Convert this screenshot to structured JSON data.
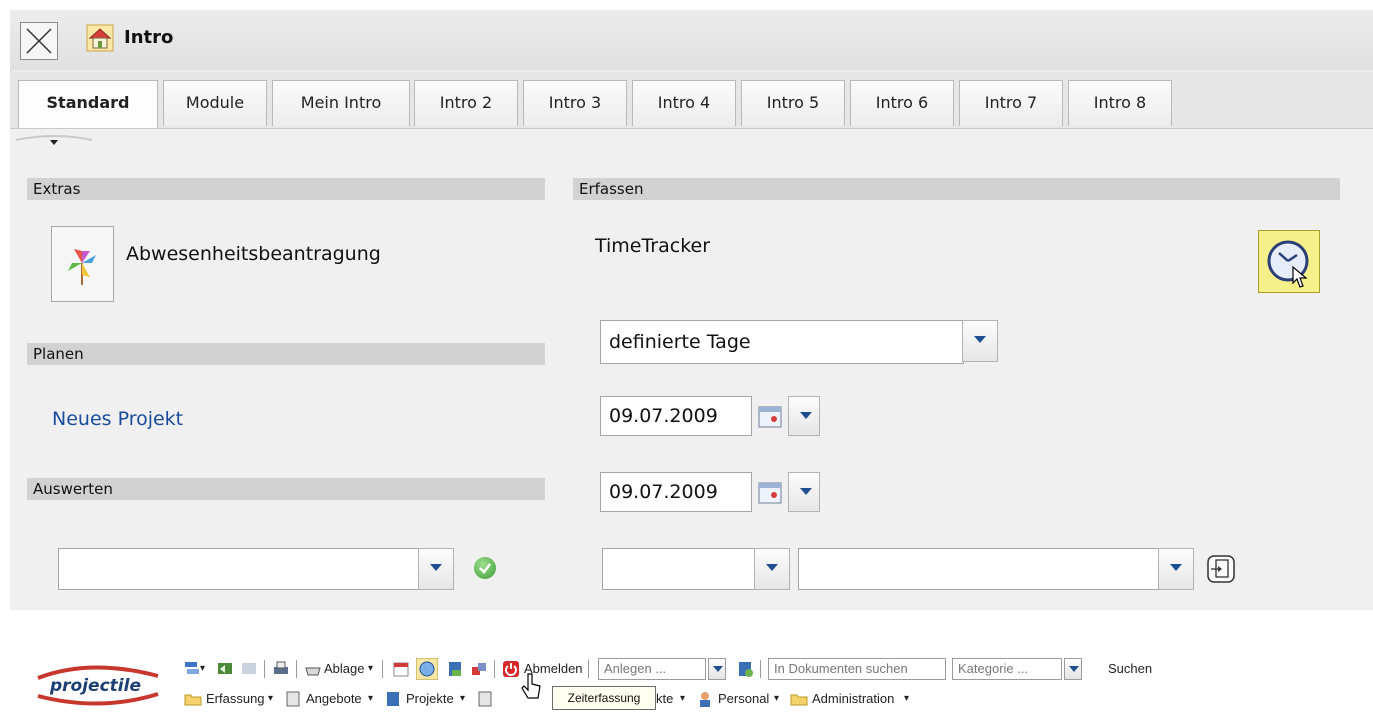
{
  "window": {
    "title": "Intro"
  },
  "tabs": [
    {
      "label": "Standard",
      "active": true
    },
    {
      "label": "Module"
    },
    {
      "label": "Mein Intro"
    },
    {
      "label": "Intro 2"
    },
    {
      "label": "Intro 3"
    },
    {
      "label": "Intro 4"
    },
    {
      "label": "Intro 5"
    },
    {
      "label": "Intro 6"
    },
    {
      "label": "Intro 7"
    },
    {
      "label": "Intro 8"
    }
  ],
  "sections": {
    "extras": "Extras",
    "erfassen": "Erfassen",
    "planen": "Planen",
    "auswerten": "Auswerten"
  },
  "extras": {
    "app_label": "Abwesenheitsbeantragung"
  },
  "planen": {
    "link": "Neues Projekt"
  },
  "erfassen": {
    "timetracker_label": "TimeTracker",
    "period_select": "definierte Tage",
    "date_from": "09.07.2009",
    "date_to": "09.07.2009"
  },
  "toolbar": {
    "ablage": "Ablage",
    "abmelden": "Abmelden",
    "anlegen_placeholder": "Anlegen ...",
    "search_placeholder": "In Dokumenten suchen",
    "kategorie_placeholder": "Kategorie ...",
    "suchen": "Suchen",
    "tooltip": "Zeiterfassung",
    "logo": "projectile",
    "menu": {
      "erfassung": "Erfassung",
      "angebote": "Angebote",
      "projekte": "Projekte",
      "kontakte": "Kontakte",
      "personal": "Personal",
      "administration": "Administration"
    }
  },
  "colors": {
    "link": "#1a4b9c",
    "section_bg": "#d2d2d2",
    "panel_bg": "#f0f0f0"
  }
}
